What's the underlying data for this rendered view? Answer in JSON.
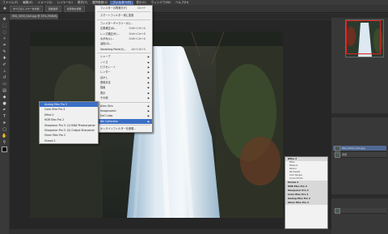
{
  "menubar": {
    "items": [
      "ファイル(F)",
      "編集(E)",
      "イメージ(I)",
      "レイヤー(L)",
      "書式(Y)",
      "選択範囲(S)",
      "フィルター(T)",
      "表示(V)",
      "ウィンドウ(W)",
      "ヘルプ(H)"
    ],
    "active_index": 6
  },
  "options": {
    "labels": [
      "すべてのレイヤーを対象",
      "自動選択",
      "境界線を調整"
    ]
  },
  "document_tab": "IMG_0050_DxO.jpg @ 33% (RGB/8)",
  "filter_menu": {
    "items": [
      {
        "label": "フィルターの再実行(F)",
        "shortcut": "Ctrl+F"
      },
      {
        "sep": true
      },
      {
        "label": "スマートフィルター用に変換"
      },
      {
        "sep": true
      },
      {
        "label": "フィルターギャラリー(G)..."
      },
      {
        "label": "広角補正(A)...",
        "shortcut": "Shift+Ctrl+A"
      },
      {
        "label": "レンズ補正(R)...",
        "shortcut": "Shift+Ctrl+R"
      },
      {
        "label": "ゆがみ(L)...",
        "shortcut": "Shift+Ctrl+X"
      },
      {
        "label": "油彩(O)..."
      },
      {
        "label": "Vanishing Point(V)...",
        "shortcut": "Alt+Ctrl+V"
      },
      {
        "sep": true
      },
      {
        "label": "シャープ",
        "sub": true
      },
      {
        "label": "ノイズ",
        "sub": true
      },
      {
        "label": "ピクセレート",
        "sub": true
      },
      {
        "label": "レンダー",
        "sub": true
      },
      {
        "label": "ぼかし",
        "sub": true
      },
      {
        "label": "表現手法",
        "sub": true
      },
      {
        "label": "描画",
        "sub": true
      },
      {
        "label": "表示",
        "sub": true
      },
      {
        "label": "その他",
        "sub": true
      },
      {
        "sep": true
      },
      {
        "label": "Alien Skin",
        "sub": true
      },
      {
        "label": "Imagenomic",
        "sub": true
      },
      {
        "label": "DxO Labs",
        "sub": true
      },
      {
        "label": "Nik Collection",
        "sub": true,
        "hl": true
      },
      {
        "sep": true
      },
      {
        "label": "オンラインフィルターを参照..."
      }
    ]
  },
  "nik_menu": {
    "items": [
      {
        "label": "Analog Efex Pro 2",
        "hl": true
      },
      {
        "label": "Color Efex Pro 4"
      },
      {
        "label": "Dfine 2"
      },
      {
        "label": "HDR Efex Pro 2"
      },
      {
        "label": "Sharpener Pro 3: (1) RAW Presharpener"
      },
      {
        "label": "Sharpener Pro 3: (2) Output Sharpener"
      },
      {
        "label": "Silver Efex Pro 2"
      },
      {
        "label": "Viveza 2"
      }
    ]
  },
  "nik_panel": {
    "sections": [
      {
        "title": "Dfine 2",
        "subs": [
          "Dfine",
          "Measure",
          "Reduce",
          "Nik Presets",
          "Color Ranges",
          "Control Points"
        ]
      },
      {
        "title": "Viveza 2",
        "subs": []
      },
      {
        "title": "HDR Efex Pro 2",
        "subs": []
      },
      {
        "title": "Sharpener Pro 3",
        "subs": []
      },
      {
        "title": "Color Efex Pro 4",
        "subs": []
      },
      {
        "title": "Analog Efex Pro 2",
        "subs": []
      },
      {
        "title": "Silver Efex Pro 2",
        "subs": []
      }
    ]
  },
  "layers": {
    "items": [
      "IMG_0050_DxO.jpg",
      "背景"
    ]
  }
}
